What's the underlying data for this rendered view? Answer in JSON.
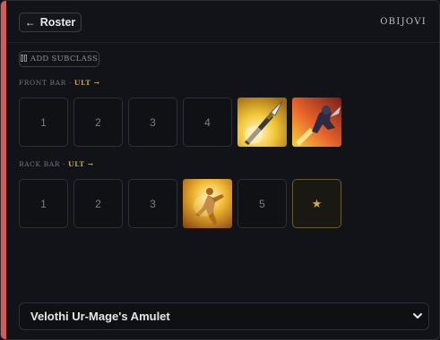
{
  "header": {
    "back_label": "Roster",
    "character_name": "OBIJOVI"
  },
  "subclass": {
    "label": "ADD SUBCLASS"
  },
  "front_bar": {
    "label": "FRONT BAR · ",
    "ult_label": "ULT →",
    "empty_slots": [
      "1",
      "2",
      "3",
      "4"
    ],
    "skills": [
      {
        "icon": "spear-throw-skill-icon"
      },
      {
        "icon": "dark-knight-charge-skill-icon"
      }
    ]
  },
  "back_bar": {
    "label": "BACK BAR · ",
    "ult_label": "ULT →",
    "empty_slots": [
      "1",
      "2",
      "3"
    ],
    "skill": {
      "icon": "radiant-figure-skill-icon"
    },
    "slot5": "5",
    "ult_star": "★"
  },
  "item_select": {
    "value": "Velothi Ur-Mage's Amulet"
  },
  "colors": {
    "accent": "#d65a5a",
    "ult": "#c7a24a"
  }
}
